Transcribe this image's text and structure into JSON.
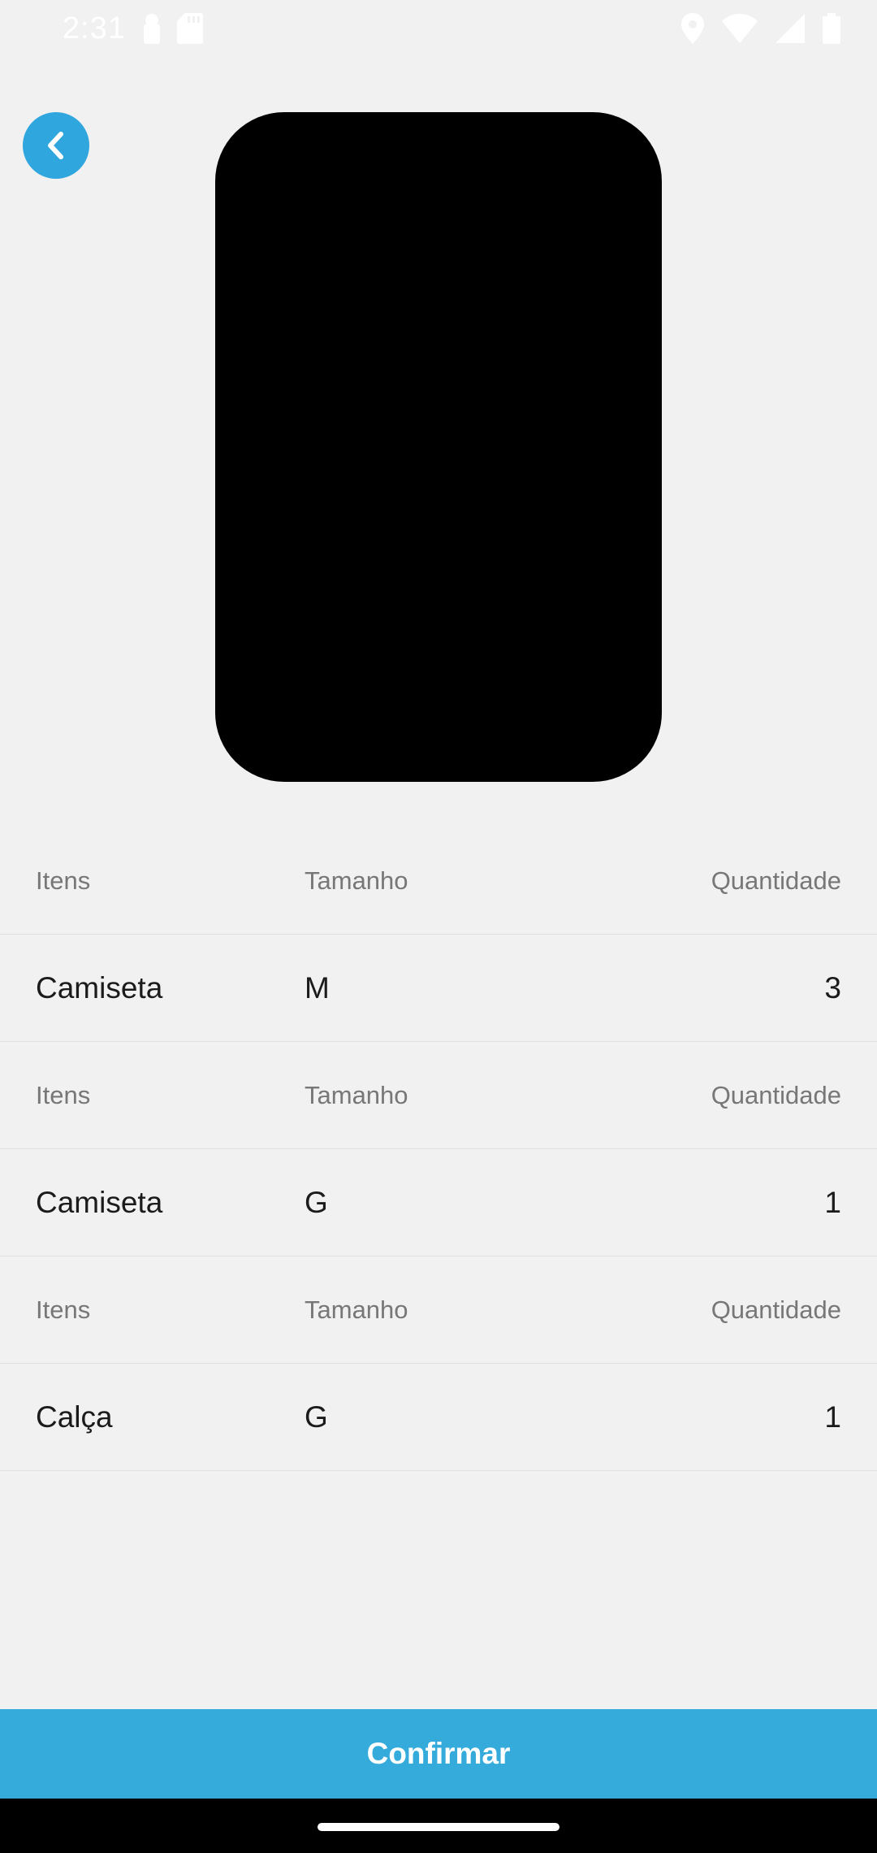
{
  "status_bar": {
    "time": "2:31",
    "icons": [
      "notification-icon",
      "sd-card-icon",
      "location-icon",
      "wifi-icon",
      "signal-icon",
      "battery-icon"
    ]
  },
  "back_button": {
    "icon": "chevron-left-icon"
  },
  "colors": {
    "accent": "#35abdc",
    "background": "#f1f1f1",
    "preview": "#000000"
  },
  "items": [
    {
      "header": {
        "item": "Itens",
        "size": "Tamanho",
        "quantity": "Quantidade"
      },
      "row": {
        "item": "Camiseta",
        "size": "M",
        "quantity": "3"
      }
    },
    {
      "header": {
        "item": "Itens",
        "size": "Tamanho",
        "quantity": "Quantidade"
      },
      "row": {
        "item": "Camiseta",
        "size": "G",
        "quantity": "1"
      }
    },
    {
      "header": {
        "item": "Itens",
        "size": "Tamanho",
        "quantity": "Quantidade"
      },
      "row": {
        "item": "Calça",
        "size": "G",
        "quantity": "1"
      }
    }
  ],
  "confirm_label": "Confirmar"
}
